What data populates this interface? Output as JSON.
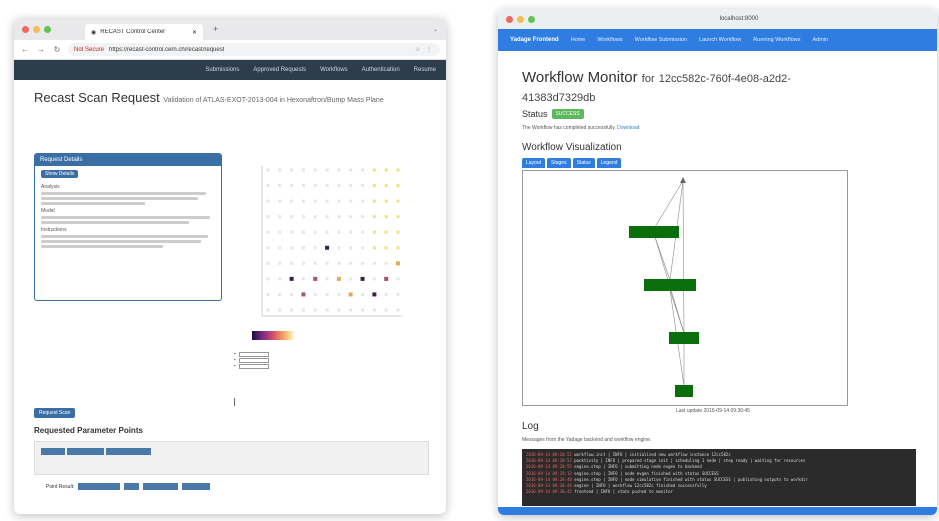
{
  "left_window": {
    "tab_title": "RECAST Control Center",
    "url_warning": "Not Secure",
    "url_text": "https://recast-control.cern.ch/recast/request",
    "nav_items": [
      "Submissions",
      "Approved Requests",
      "Workflows",
      "Authentication",
      "Resume"
    ],
    "page_title": "Recast Scan Request",
    "page_subtitle": "Validation of ATLAS-EXOT-2013-004 in Hexonaftron/Bump Mass Plane",
    "request_panel": {
      "header": "Request Details",
      "button": "Show Details",
      "labels": [
        "Analysis",
        "Model",
        "Instructions"
      ]
    },
    "scan_button": "Request Scan",
    "params_title": "Requested Parameter Points",
    "footer_label": "Point Result:"
  },
  "right_window": {
    "tab_title": "localhost:8000",
    "brand": "Yadage Frontend",
    "nav_items": [
      "Home",
      "Workflows",
      "Workflow Submission",
      "Launch Workflow",
      "Running Workflows",
      "Admin"
    ],
    "page_title": "Workflow Monitor",
    "title_for": "for",
    "workflow_id": "12cc582c-760f-4e08-a2d2-41383d7329db",
    "status_label": "Status",
    "status_value": "SUCCESS",
    "completed_text": "The Workflow has completed successfully.",
    "completed_link": "Download",
    "viz_title": "Workflow Visualization",
    "viz_tabs": [
      "Layout",
      "Stages",
      "Status",
      "Legend"
    ],
    "graph_caption": "Last update 2016-09-14 09:30:45",
    "log_title": "Log",
    "log_sub": "Messages from the Yadage backend and workflow engine.",
    "log_lines": [
      {
        "ts": "2016-09-14 09:28:51",
        "msg": "workflow.init | INFO | initialized new workflow instance 12cc582c"
      },
      {
        "ts": "2016-09-14 09:28:52",
        "msg": "packtivity | INFO | prepared stage init | scheduling 1 node | step ready | waiting for resources"
      },
      {
        "ts": "2016-09-14 09:28:55",
        "msg": "engine.step | INFO | submitting node evgen to backend"
      },
      {
        "ts": "2016-09-14 09:29:12",
        "msg": "engine.step | INFO | node evgen finished with status SUCCESS"
      },
      {
        "ts": "2016-09-14 09:29:40",
        "msg": "engine.step | INFO | node simulation finished with status SUCCESS | publishing outputs to workdir"
      },
      {
        "ts": "2016-09-14 09:30:44",
        "msg": "engine | INFO | workflow 12cc582c finished successfully"
      },
      {
        "ts": "2016-09-14 09:30:45",
        "msg": "frontend | INFO | state pushed to monitor"
      }
    ]
  },
  "colors": {
    "left_nav": "#2e3d4b",
    "left_accent": "#3a6fa5",
    "right_accent": "#2f7de1",
    "node_green": "#0a6e0a",
    "status_green": "#5cb85c"
  }
}
